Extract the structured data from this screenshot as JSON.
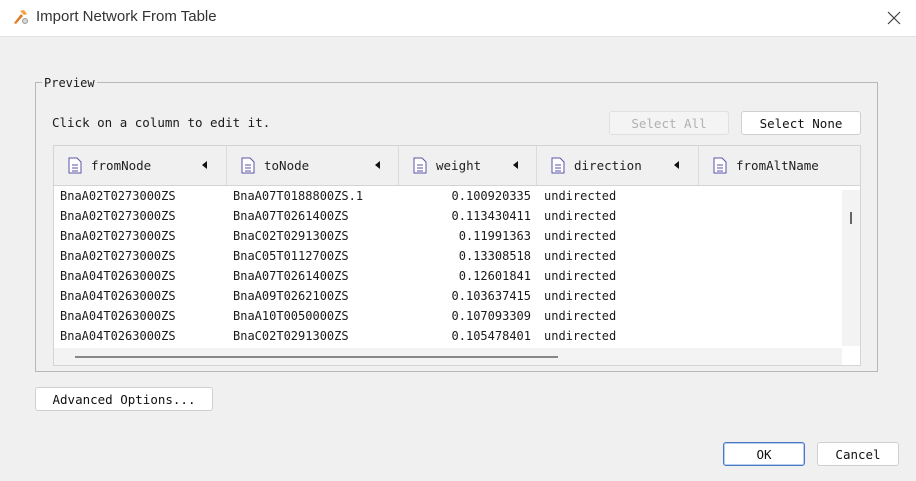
{
  "window": {
    "title": "Import Network From Table"
  },
  "preview": {
    "legend": "Preview",
    "instruction": "Click on a column to edit it.",
    "select_all_label": "Select All",
    "select_none_label": "Select None"
  },
  "table": {
    "columns": [
      {
        "label": "fromNode"
      },
      {
        "label": "toNode"
      },
      {
        "label": "weight"
      },
      {
        "label": "direction"
      },
      {
        "label": "fromAltName"
      }
    ],
    "rows": [
      {
        "fromNode": "BnaA02T0273000ZS",
        "toNode": "BnaA07T0188800ZS.1",
        "weight": "0.100920335",
        "direction": "undirected"
      },
      {
        "fromNode": "BnaA02T0273000ZS",
        "toNode": "BnaA07T0261400ZS",
        "weight": "0.113430411",
        "direction": "undirected"
      },
      {
        "fromNode": "BnaA02T0273000ZS",
        "toNode": "BnaC02T0291300ZS",
        "weight": "0.11991363",
        "direction": "undirected"
      },
      {
        "fromNode": "BnaA02T0273000ZS",
        "toNode": "BnaC05T0112700ZS",
        "weight": "0.13308518",
        "direction": "undirected"
      },
      {
        "fromNode": "BnaA04T0263000ZS",
        "toNode": "BnaA07T0261400ZS",
        "weight": "0.12601841",
        "direction": "undirected"
      },
      {
        "fromNode": "BnaA04T0263000ZS",
        "toNode": "BnaA09T0262100ZS",
        "weight": "0.103637415",
        "direction": "undirected"
      },
      {
        "fromNode": "BnaA04T0263000ZS",
        "toNode": "BnaA10T0050000ZS",
        "weight": "0.107093309",
        "direction": "undirected"
      },
      {
        "fromNode": "BnaA04T0263000ZS",
        "toNode": "BnaC02T0291300ZS",
        "weight": "0.105478401",
        "direction": "undirected"
      }
    ]
  },
  "footer": {
    "advanced_label": "Advanced Options...",
    "ok_label": "OK",
    "cancel_label": "Cancel"
  }
}
